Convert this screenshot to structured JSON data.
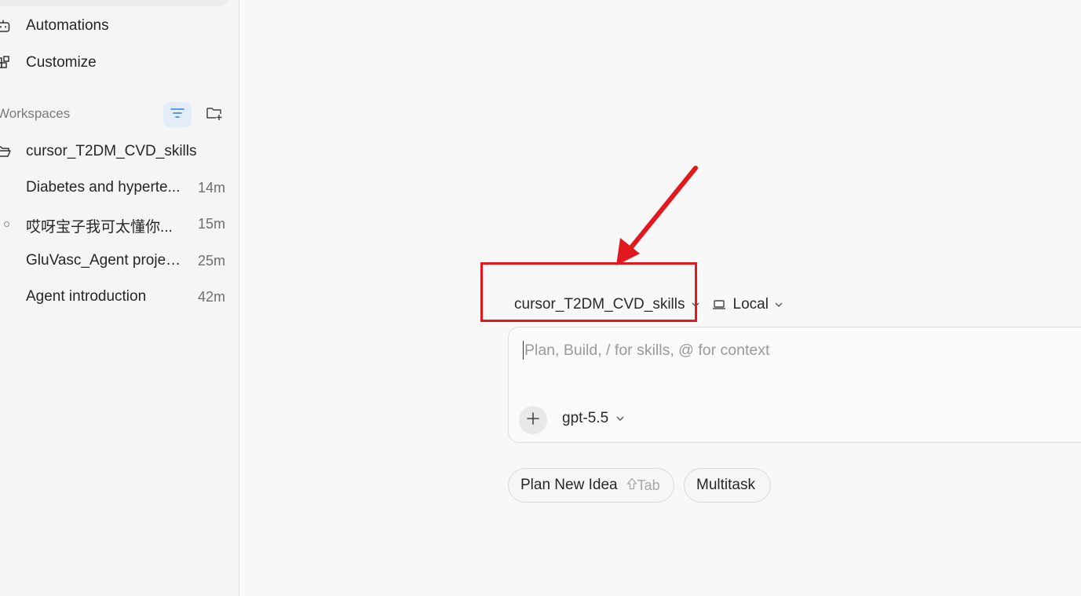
{
  "sidebar": {
    "nav": [
      {
        "label": "Automations",
        "icon": "robot-icon"
      },
      {
        "label": "Customize",
        "icon": "blocks-icon"
      }
    ],
    "workspaces": {
      "title": "Workspaces",
      "filter_icon": "filter-icon",
      "new_folder_icon": "new-folder-icon",
      "folder": {
        "label": "cursor_T2DM_CVD_skills",
        "icon": "folder-open-icon"
      },
      "threads": [
        {
          "title": "Diabetes and hyperte...",
          "time": "14m"
        },
        {
          "title": "哎呀宝子我可太懂你...",
          "time": "15m"
        },
        {
          "title": "GluVasc_Agent project...",
          "time": "25m"
        },
        {
          "title": "Agent introduction",
          "time": "42m"
        }
      ]
    }
  },
  "main": {
    "workspace_selector": "cursor_T2DM_CVD_skills",
    "location_selector": "Local",
    "composer": {
      "placeholder": "Plan, Build, / for skills, @ for context",
      "model": "gpt-5.5"
    },
    "chips": [
      {
        "label": "Plan New Idea",
        "hint": "Tab"
      },
      {
        "label": "Multitask"
      }
    ]
  },
  "annotation": {
    "box_color": "#e2181f",
    "arrow_color": "#e2181f"
  }
}
